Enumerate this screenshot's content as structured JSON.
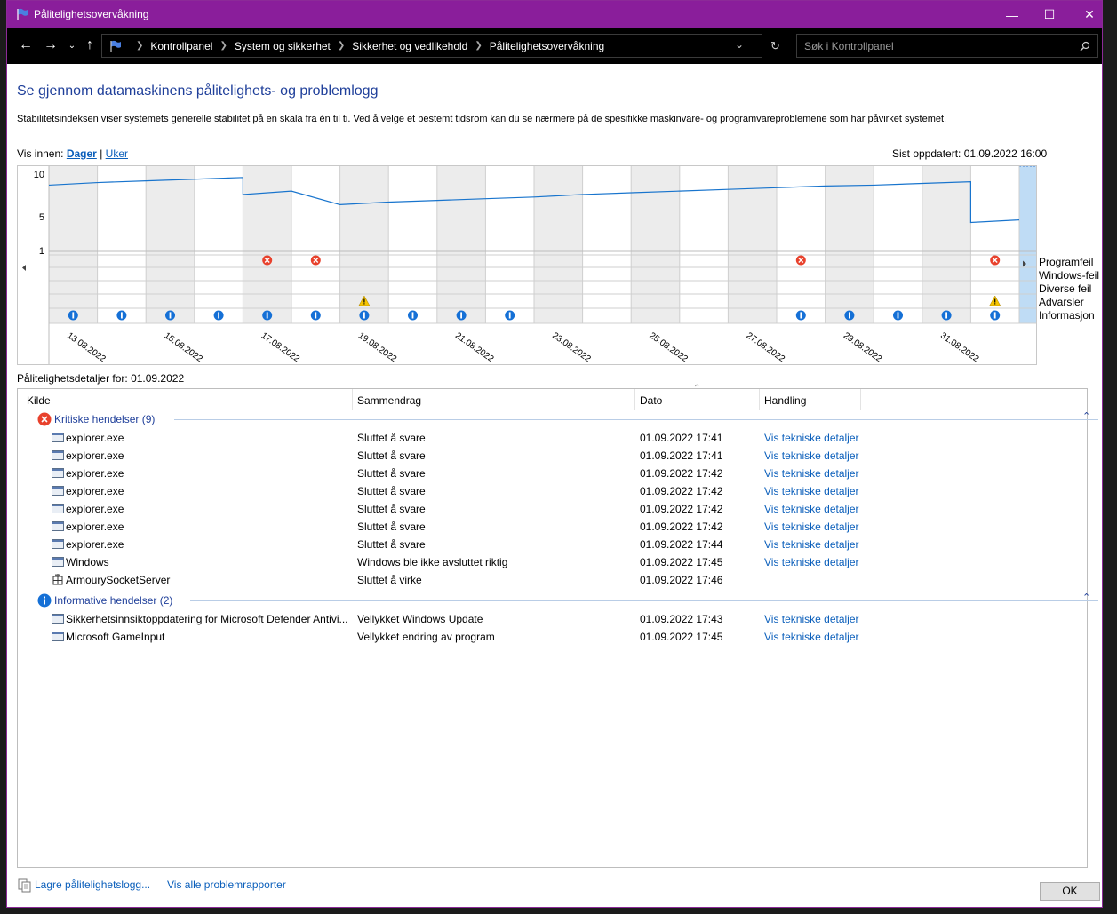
{
  "window": {
    "title": "Pålitelighetsovervåkning",
    "controls": {
      "minimize": "—",
      "maximize": "☐",
      "close": "✕"
    }
  },
  "address": {
    "crumbs": [
      "Kontrollpanel",
      "System og sikkerhet",
      "Sikkerhet og vedlikehold",
      "Pålitelighetsovervåkning"
    ],
    "search_placeholder": "Søk i Kontrollpanel"
  },
  "page": {
    "heading": "Se gjennom datamaskinens pålitelighets- og problemlogg",
    "description": "Stabilitetsindeksen viser systemets generelle stabilitet på en skala fra én til ti. Ved å velge et bestemt tidsrom kan du se nærmere på de spesifikke maskinvare- og programvareproblemene som har påvirket systemet.",
    "view_label": "Vis innen:",
    "view_days": "Dager",
    "view_sep": "|",
    "view_weeks": "Uker",
    "last_updated": "Sist oppdatert: 01.09.2022 16:00"
  },
  "chart_data": {
    "type": "line",
    "y_ticks": [
      "10",
      "5",
      "1"
    ],
    "ylim": [
      1,
      10
    ],
    "date_labels": [
      "13.08.2022",
      "15.08.2022",
      "17.08.2022",
      "19.08.2022",
      "21.08.2022",
      "23.08.2022",
      "25.08.2022",
      "27.08.2022",
      "29.08.2022",
      "31.08.2022"
    ],
    "columns": 20,
    "selected_column": 19,
    "stability_index": [
      {
        "col": 0,
        "start": 8.7,
        "end": 9.0
      },
      {
        "col": 1,
        "start": 9.0,
        "end": 9.2
      },
      {
        "col": 2,
        "start": 9.2,
        "end": 9.4
      },
      {
        "col": 3,
        "start": 9.4,
        "end": 9.6
      },
      {
        "col": 4,
        "start": 7.6,
        "end": 8.0
      },
      {
        "col": 5,
        "start": 8.0,
        "end": 6.4
      },
      {
        "col": 6,
        "start": 6.4,
        "end": 6.7
      },
      {
        "col": 7,
        "start": 6.7,
        "end": 6.9
      },
      {
        "col": 8,
        "start": 6.9,
        "end": 7.1
      },
      {
        "col": 9,
        "start": 7.1,
        "end": 7.3
      },
      {
        "col": 10,
        "start": 7.3,
        "end": 7.6
      },
      {
        "col": 11,
        "start": 7.6,
        "end": 7.8
      },
      {
        "col": 12,
        "start": 7.8,
        "end": 8.0
      },
      {
        "col": 13,
        "start": 8.0,
        "end": 8.2
      },
      {
        "col": 14,
        "start": 8.2,
        "end": 8.4
      },
      {
        "col": 15,
        "start": 8.4,
        "end": 8.6
      },
      {
        "col": 16,
        "start": 8.6,
        "end": 8.7
      },
      {
        "col": 17,
        "start": 8.7,
        "end": 8.9
      },
      {
        "col": 18,
        "start": 8.9,
        "end": 9.1
      },
      {
        "col": 19,
        "start": 4.3,
        "end": 4.6
      }
    ],
    "rows": [
      "Programfeil",
      "Windows-feil",
      "Diverse feil",
      "Advarsler",
      "Informasjon"
    ],
    "events": [
      {
        "col": 4,
        "row": 0,
        "kind": "error"
      },
      {
        "col": 5,
        "row": 0,
        "kind": "error"
      },
      {
        "col": 15,
        "row": 0,
        "kind": "error"
      },
      {
        "col": 19,
        "row": 0,
        "kind": "error"
      },
      {
        "col": 20,
        "row": 0,
        "kind": "error"
      },
      {
        "col": 20,
        "row": 2,
        "kind": "error"
      },
      {
        "col": 6,
        "row": 3,
        "kind": "warning"
      },
      {
        "col": 19,
        "row": 3,
        "kind": "warning"
      },
      {
        "col": 0,
        "row": 4,
        "kind": "info"
      },
      {
        "col": 1,
        "row": 4,
        "kind": "info"
      },
      {
        "col": 2,
        "row": 4,
        "kind": "info"
      },
      {
        "col": 3,
        "row": 4,
        "kind": "info"
      },
      {
        "col": 4,
        "row": 4,
        "kind": "info"
      },
      {
        "col": 5,
        "row": 4,
        "kind": "info"
      },
      {
        "col": 6,
        "row": 4,
        "kind": "info"
      },
      {
        "col": 7,
        "row": 4,
        "kind": "info"
      },
      {
        "col": 8,
        "row": 4,
        "kind": "info"
      },
      {
        "col": 9,
        "row": 4,
        "kind": "info"
      },
      {
        "col": 15,
        "row": 4,
        "kind": "info"
      },
      {
        "col": 16,
        "row": 4,
        "kind": "info"
      },
      {
        "col": 17,
        "row": 4,
        "kind": "info"
      },
      {
        "col": 18,
        "row": 4,
        "kind": "info"
      },
      {
        "col": 19,
        "row": 4,
        "kind": "info"
      },
      {
        "col": 20,
        "row": 4,
        "kind": "info"
      }
    ],
    "colors": {
      "line": "#1874cd",
      "shade": "#ececec",
      "selected": "#bfdcf5",
      "error": "#e8412c",
      "warning": "#f5c400",
      "info": "#1570d6"
    }
  },
  "details": {
    "title": "Pålitelighetsdetaljer for: 01.09.2022",
    "columns": [
      "Kilde",
      "Sammendrag",
      "Dato",
      "Handling"
    ],
    "groups": [
      {
        "label": "Kritiske hendelser (9)",
        "icon": "error-icon",
        "rows": [
          {
            "source": "explorer.exe",
            "summary": "Sluttet å svare",
            "date": "01.09.2022 17:41",
            "action": "Vis tekniske detaljer"
          },
          {
            "source": "explorer.exe",
            "summary": "Sluttet å svare",
            "date": "01.09.2022 17:41",
            "action": "Vis tekniske detaljer"
          },
          {
            "source": "explorer.exe",
            "summary": "Sluttet å svare",
            "date": "01.09.2022 17:42",
            "action": "Vis tekniske detaljer"
          },
          {
            "source": "explorer.exe",
            "summary": "Sluttet å svare",
            "date": "01.09.2022 17:42",
            "action": "Vis tekniske detaljer"
          },
          {
            "source": "explorer.exe",
            "summary": "Sluttet å svare",
            "date": "01.09.2022 17:42",
            "action": "Vis tekniske detaljer"
          },
          {
            "source": "explorer.exe",
            "summary": "Sluttet å svare",
            "date": "01.09.2022 17:42",
            "action": "Vis tekniske detaljer"
          },
          {
            "source": "explorer.exe",
            "summary": "Sluttet å svare",
            "date": "01.09.2022 17:44",
            "action": "Vis tekniske detaljer"
          },
          {
            "source": "Windows",
            "summary": "Windows ble ikke avsluttet riktig",
            "date": "01.09.2022 17:45",
            "action": "Vis tekniske detaljer"
          },
          {
            "source": "ArmourySocketServer",
            "summary": "Sluttet å virke",
            "date": "01.09.2022 17:46",
            "action": ""
          }
        ]
      },
      {
        "label": "Informative hendelser (2)",
        "icon": "info-icon",
        "rows": [
          {
            "source": "Sikkerhetsinnsiktoppdatering for Microsoft Defender Antivi...",
            "summary": "Vellykket Windows Update",
            "date": "01.09.2022 17:43",
            "action": "Vis tekniske detaljer"
          },
          {
            "source": "Microsoft GameInput",
            "summary": "Vellykket endring av program",
            "date": "01.09.2022 17:45",
            "action": "Vis tekniske detaljer"
          }
        ]
      }
    ]
  },
  "footer": {
    "save_link": "Lagre pålitelighetslogg...",
    "reports_link": "Vis alle problemrapporter",
    "ok": "OK"
  }
}
